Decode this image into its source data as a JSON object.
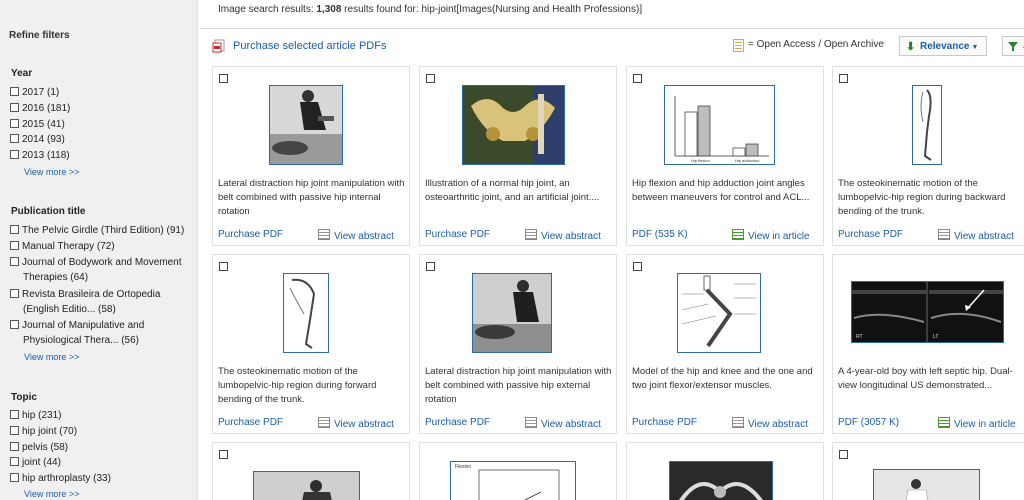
{
  "header": {
    "prefix": "Image search results: ",
    "count": "1,308",
    "suffix": " results found for: hip-joint[Images(Nursing and Health Professions)]"
  },
  "sidebar": {
    "title": "Refine filters",
    "year": {
      "heading": "Year",
      "items": [
        "2017  (1)",
        "2016  (181)",
        "2015  (41)",
        "2014  (93)",
        "2013  (118)"
      ],
      "more": "View more >>"
    },
    "publication": {
      "heading": "Publication title",
      "items": [
        "The Pelvic Girdle (Third Edition)  (91)",
        "Manual Therapy  (72)",
        "Journal of Bodywork and Movement",
        "Therapies  (64)",
        "Revista Brasileira de Ortopedia",
        "(English Editio...  (58)",
        "Journal of Manipulative and",
        "Physiological Thera...  (56)"
      ],
      "more": "View more >>"
    },
    "topic": {
      "heading": "Topic",
      "items": [
        "hip  (231)",
        "hip joint  (70)",
        "pelvis  (58)",
        "joint  (44)",
        "hip arthroplasty  (33)"
      ],
      "more": "View more >>"
    }
  },
  "toolbar": {
    "purchase_selected": "Purchase selected article PDFs",
    "open_access": "= Open Access / Open Archive",
    "relevance": "Relevance",
    "filter_label": "A"
  },
  "cards": [
    {
      "caption": "Lateral distraction hip joint manipulation with belt combined with passive hip internal rotation",
      "left": "Purchase PDF",
      "right": "View abstract",
      "right_type": "abstract"
    },
    {
      "caption": "Illustration of a normal hip joint, an osteoarthritic joint, and an artificial joint....",
      "left": "Purchase PDF",
      "right": "View abstract",
      "right_type": "abstract"
    },
    {
      "caption": "Hip flexion and hip adduction joint angles between maneuvers for control and ACL...",
      "left": "PDF (535 K)",
      "right": "View in article",
      "right_type": "article"
    },
    {
      "caption": "The osteokinematic motion of the lumbopelvic-hip region during backward bending of the trunk.",
      "left": "Purchase PDF",
      "right": "View abstract",
      "right_type": "abstract"
    },
    {
      "caption": "The osteokinematic motion of the lumbopelvic-hip region during forward bending of the trunk.",
      "left": "Purchase PDF",
      "right": "View abstract",
      "right_type": "abstract"
    },
    {
      "caption": "Lateral distraction hip joint manipulation with belt combined with passive hip external rotation",
      "left": "Purchase PDF",
      "right": "View abstract",
      "right_type": "abstract"
    },
    {
      "caption": "Model of the hip and knee and the one and two joint flexor/extensor muscles.",
      "left": "Purchase PDF",
      "right": "View abstract",
      "right_type": "abstract"
    },
    {
      "caption": "A 4-year-old boy with left septic hip. Dual-view longitudinal US demonstrated...",
      "left": "PDF (3057 K)",
      "right": "View in article",
      "right_type": "article"
    }
  ],
  "thumb_text": {
    "chart_label": "Flexion",
    "chart_legend_1": "Hip flexion",
    "chart_legend_2": "Hip adduction",
    "us_label_1": "RT",
    "us_label_2": "LT"
  },
  "colors": {
    "link": "#1a5ea6",
    "sidebar_bg": "#f0f0f0",
    "thumb_border": "#2c6aa8"
  }
}
